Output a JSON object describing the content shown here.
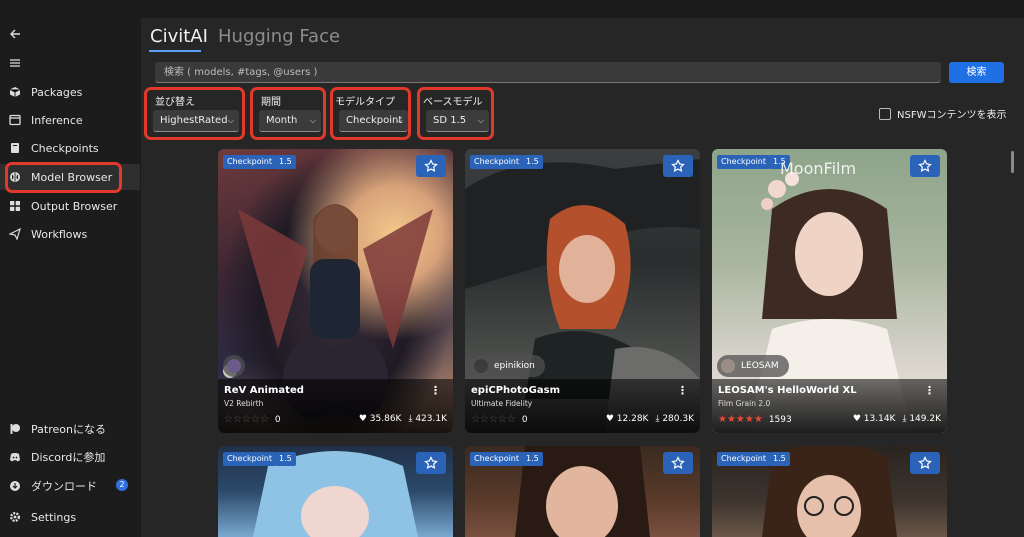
{
  "sidebar": {
    "items": [
      {
        "label": "Packages",
        "icon": "cube-icon"
      },
      {
        "label": "Inference",
        "icon": "window-icon"
      },
      {
        "label": "Checkpoints",
        "icon": "file-icon"
      },
      {
        "label": "Model Browser",
        "icon": "brain-icon"
      },
      {
        "label": "Output Browser",
        "icon": "grid-icon"
      },
      {
        "label": "Workflows",
        "icon": "send-icon"
      }
    ],
    "bottom_items": [
      {
        "label": "Patreonになる",
        "icon": "patreon-icon"
      },
      {
        "label": "Discordに参加",
        "icon": "discord-icon"
      },
      {
        "label": "ダウンロード",
        "icon": "download-icon",
        "badge": "2"
      },
      {
        "label": "Settings",
        "icon": "gear-icon"
      }
    ]
  },
  "tabs": [
    "CivitAI",
    "Hugging Face"
  ],
  "search": {
    "placeholder": "検索 ( models, #tags, @users )",
    "button": "検索"
  },
  "filters": [
    {
      "label": "並び替え",
      "value": "HighestRated"
    },
    {
      "label": "期間",
      "value": "Month"
    },
    {
      "label": "モデルタイプ",
      "value": "Checkpoint"
    },
    {
      "label": "ベースモデル",
      "value": "SD 1.5"
    }
  ],
  "nsfw_label": "NSFWコンテンツを表示",
  "cards": [
    {
      "type": "Checkpoint",
      "version": "1.5",
      "title": "ReV Animated",
      "subtitle": "V2 Rebirth",
      "creator": "",
      "rating_count": "0",
      "likes": "35.86K",
      "downloads": "423.1K",
      "rated": false
    },
    {
      "type": "Checkpoint",
      "version": "1.5",
      "title": "epiCPhotoGasm",
      "subtitle": "Ultimate Fidelity",
      "creator": "epinikion",
      "rating_count": "0",
      "likes": "12.28K",
      "downloads": "280.3K",
      "rated": false
    },
    {
      "type": "Checkpoint",
      "version": "1.5",
      "title": "LEOSAM's HelloWorld XL",
      "subtitle": "Film Grain 2.0",
      "creator": "LEOSAM",
      "rating_count": "1593",
      "likes": "13.14K",
      "downloads": "149.2K",
      "rated": true
    },
    {
      "type": "Checkpoint",
      "version": "1.5"
    },
    {
      "type": "Checkpoint",
      "version": "1.5"
    },
    {
      "type": "Checkpoint",
      "version": "1.5"
    }
  ],
  "card_overlay_text": "MoonFilm",
  "colors": {
    "accent": "#1f6fe5",
    "highlight": "#e23a2a",
    "star": "#e8483a"
  }
}
